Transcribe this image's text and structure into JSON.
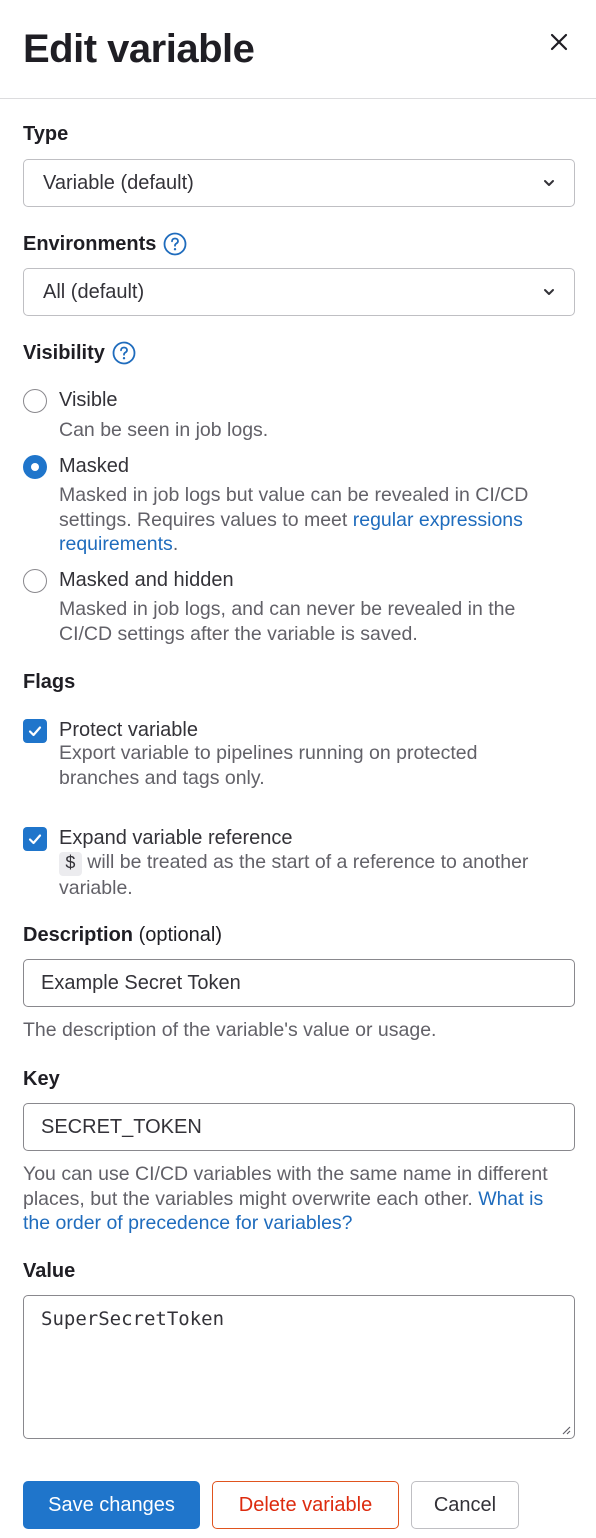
{
  "drawer": {
    "title": "Edit variable",
    "close_icon": "close-icon"
  },
  "type": {
    "label": "Type",
    "selected": "Variable (default)"
  },
  "environments": {
    "label": "Environments",
    "selected": "All (default)"
  },
  "visibility": {
    "label": "Visibility",
    "selected": "Masked",
    "options": [
      {
        "label": "Visible",
        "help": "Can be seen in job logs."
      },
      {
        "label": "Masked",
        "help_prefix": "Masked in job logs but value can be revealed in CI/CD settings. Requires values to meet ",
        "help_link": "regular expressions requirements",
        "help_suffix": "."
      },
      {
        "label": "Masked and hidden",
        "help": "Masked in job logs, and can never be revealed in the CI/CD settings after the variable is saved."
      }
    ]
  },
  "flags": {
    "label": "Flags",
    "items": [
      {
        "label": "Protect variable",
        "checked": true,
        "help": "Export variable to pipelines running on protected branches and tags only."
      },
      {
        "label": "Expand variable reference",
        "checked": true,
        "help_code": "$",
        "help": "will be treated as the start of a reference to another variable."
      }
    ]
  },
  "description": {
    "label": "Description",
    "optional": "(optional)",
    "value": "Example Secret Token",
    "help": "The description of the variable's value or usage."
  },
  "key": {
    "label": "Key",
    "value": "SECRET_TOKEN",
    "help_prefix": "You can use CI/CD variables with the same name in different places, but the variables might overwrite each other. ",
    "help_link": "What is the order of precedence for variables?"
  },
  "value": {
    "label": "Value",
    "value": "SuperSecretToken"
  },
  "actions": {
    "save": "Save changes",
    "delete": "Delete variable",
    "cancel": "Cancel"
  },
  "colors": {
    "primary": "#1f75cb",
    "danger": "#dd2b0e",
    "link": "#1f6cbd"
  }
}
